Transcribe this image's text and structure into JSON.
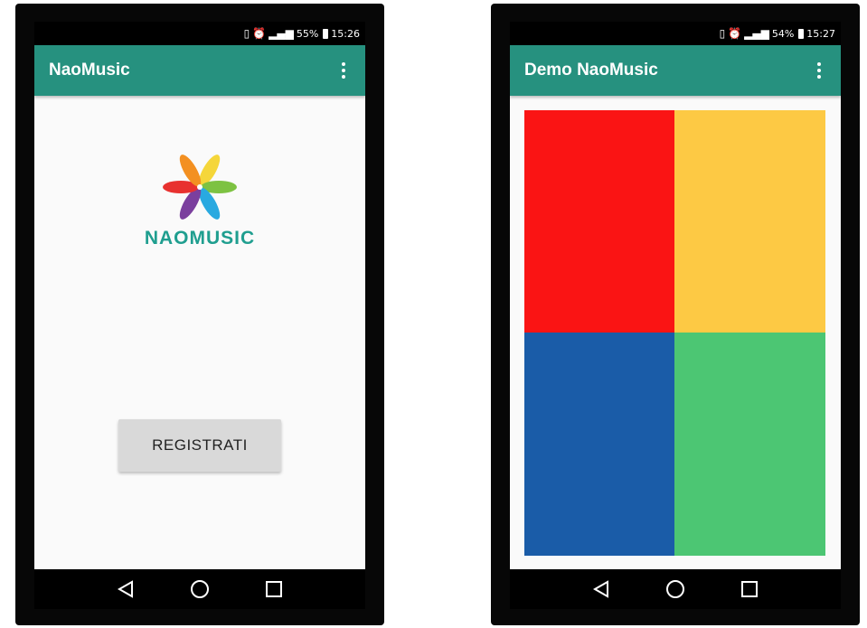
{
  "left_phone": {
    "status": {
      "battery": "55%",
      "time": "15:26",
      "icons": [
        "vibrate-icon",
        "alarm-icon",
        "signal-icon"
      ]
    },
    "app_bar": {
      "title": "NaoMusic"
    },
    "logo": {
      "text": "NAOMUSIC"
    },
    "register_button": {
      "label": "REGISTRATI"
    }
  },
  "right_phone": {
    "status": {
      "battery": "54%",
      "time": "15:27",
      "icons": [
        "vibrate-icon",
        "alarm-icon",
        "signal-icon"
      ]
    },
    "app_bar": {
      "title": "Demo NaoMusic"
    },
    "tiles": [
      {
        "name": "red",
        "color": "#fa1414"
      },
      {
        "name": "yellow",
        "color": "#fdc944"
      },
      {
        "name": "blue",
        "color": "#1a5ca8"
      },
      {
        "name": "green",
        "color": "#4cc673"
      }
    ]
  },
  "colors": {
    "app_bar": "#26917f",
    "logo_text": "#1f9e8f",
    "button_bg": "#d9d9d9",
    "screen_bg": "#fafafa"
  },
  "nav_icons": [
    "back-icon",
    "home-icon",
    "recents-icon"
  ]
}
